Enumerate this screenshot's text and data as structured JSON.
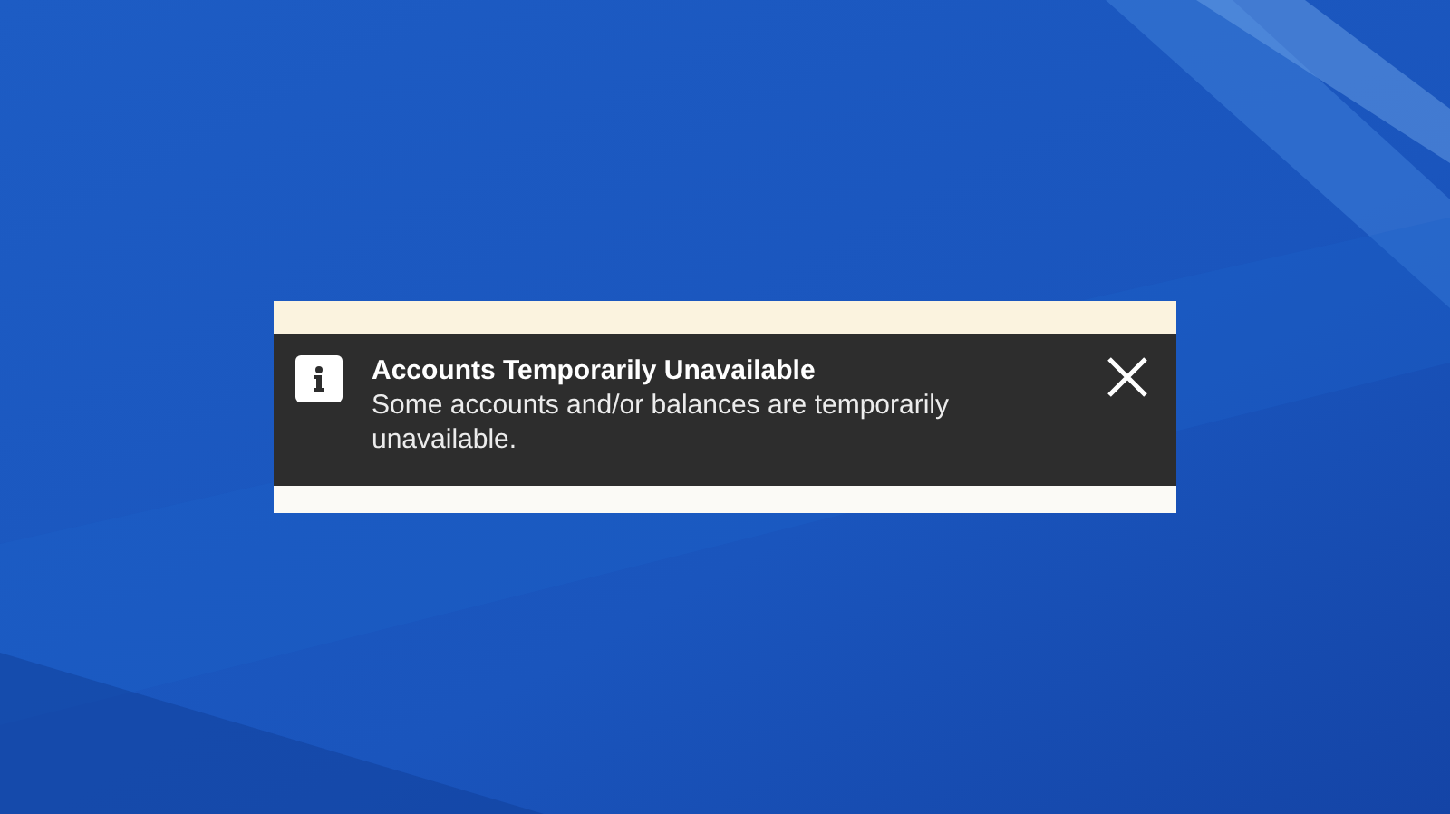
{
  "alert": {
    "title": "Accounts Temporarily Unavailable",
    "message": "Some accounts and/or balances are temporarily unavailable.",
    "dismissible": true
  }
}
